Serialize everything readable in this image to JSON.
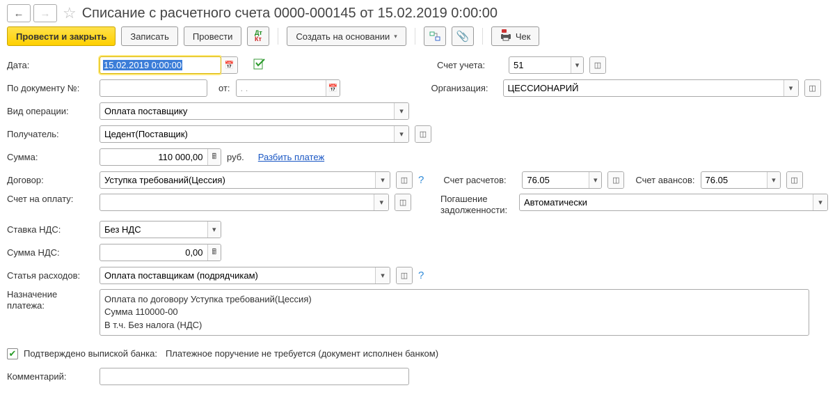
{
  "header": {
    "title": "Списание с расчетного счета 0000-000145 от 15.02.2019 0:00:00"
  },
  "toolbar": {
    "post_close": "Провести и закрыть",
    "save": "Записать",
    "post": "Провести",
    "create_based": "Создать на основании",
    "check": "Чек"
  },
  "labels": {
    "date": "Дата:",
    "doc_no": "По документу №:",
    "from": "от:",
    "op_type": "Вид операции:",
    "payee": "Получатель:",
    "sum": "Сумма:",
    "rub": "руб.",
    "split": "Разбить платеж",
    "contract": "Договор:",
    "invoice": "Счет на оплату:",
    "vat_rate": "Ставка НДС:",
    "vat_sum": "Сумма НДС:",
    "expense": "Статья расходов:",
    "purpose": "Назначение платежа:",
    "account": "Счет учета:",
    "org": "Организация:",
    "acc_calc": "Счет расчетов:",
    "acc_advance": "Счет авансов:",
    "debt": "Погашение задолженности:",
    "confirmed": "Подтверждено выпиской банка:",
    "pporder": "Платежное поручение не требуется (документ исполнен банком)",
    "comment": "Комментарий:"
  },
  "fields": {
    "date": "15.02.2019  0:00:00",
    "doc_no": "",
    "doc_from": ". .",
    "op_type": "Оплата поставщику",
    "payee": "Цедент(Поставщик)",
    "sum": "110 000,00",
    "contract": "Уступка требований(Цессия)",
    "invoice": "",
    "vat_rate": "Без НДС",
    "vat_sum": "0,00",
    "expense": "Оплата поставщикам (подрядчикам)",
    "purpose": "Оплата по договору Уступка требований(Цессия)\nСумма 110000-00\nВ т.ч. Без налога (НДС)",
    "account": "51",
    "org": "ЦЕССИОНАРИЙ",
    "acc_calc": "76.05",
    "acc_advance": "76.05",
    "debt": "Автоматически",
    "confirmed": true,
    "comment": ""
  }
}
